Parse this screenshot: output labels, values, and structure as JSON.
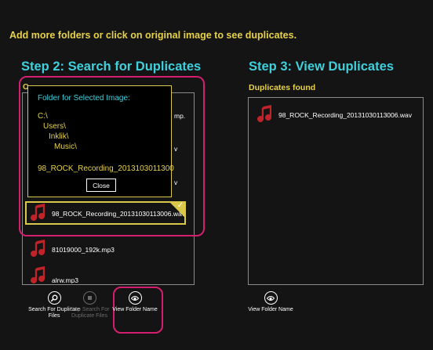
{
  "hint": "Add more folders or click on original image to see duplicates.",
  "step2": {
    "title": "Step 2: Search for Duplicates",
    "partial_letter": "O"
  },
  "list": {
    "partial_text_1": "mp.",
    "partial_text_2": "v",
    "partial_text_3": "v",
    "selected_file": "98_ROCK_Recording_20131030113006.wav",
    "file_2": "81019000_192k.mp3",
    "file_3": "alrw.mp3"
  },
  "popup": {
    "title": "Folder for Selected Image:",
    "path_lines": [
      "C:\\",
      "Users\\",
      "Inklik\\",
      "Music\\"
    ],
    "file": "98_ROCK_Recording_2013103011300",
    "close_label": "Close"
  },
  "buttons": {
    "search": "Search For Duplicate Files",
    "stop": "Stop Search For Duplicate Files",
    "view_folder": "View Folder Name",
    "view_folder_right": "View Folder Name"
  },
  "step3": {
    "title": "Step 3: View Duplicates",
    "subtitle": "Duplicates found",
    "duplicate_file": "98_ROCK_Recording_20131030113006.wav"
  },
  "icons": {
    "music": "music-note-icon",
    "search": "search-icon",
    "stop": "stop-icon",
    "eye": "eye-icon"
  },
  "colors": {
    "accent_cyan": "#3fd0dc",
    "accent_yellow": "#e6d24a",
    "highlight_pink": "#d41f70",
    "music_red": "#c0242a"
  }
}
